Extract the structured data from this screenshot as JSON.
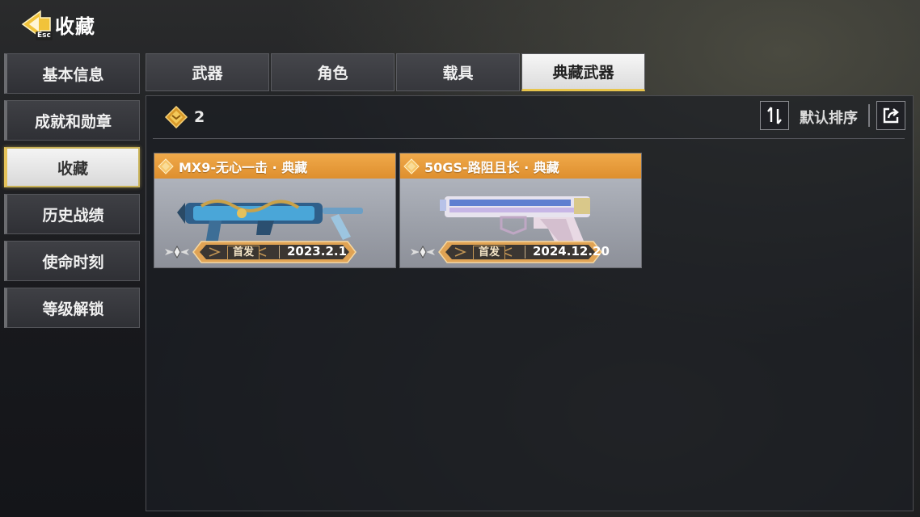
{
  "header": {
    "title": "收藏",
    "esc_label": "Esc"
  },
  "sidebar": {
    "items": [
      {
        "label": "基本信息",
        "active": false
      },
      {
        "label": "成就和勋章",
        "active": false
      },
      {
        "label": "收藏",
        "active": true
      },
      {
        "label": "历史战绩",
        "active": false
      },
      {
        "label": "使命时刻",
        "active": false
      },
      {
        "label": "等级解锁",
        "active": false
      }
    ]
  },
  "tabs": [
    {
      "label": "武器",
      "active": false
    },
    {
      "label": "角色",
      "active": false
    },
    {
      "label": "载具",
      "active": false
    },
    {
      "label": "典藏武器",
      "active": true
    }
  ],
  "toolbar": {
    "count": "2",
    "sort_label": "默认排序",
    "icons": {
      "count": "diamond-rank-icon",
      "sort": "sort-arrows-icon",
      "share": "share-icon"
    }
  },
  "cards": [
    {
      "title": "MX9-无心一击 · 典藏",
      "first_label": "首发",
      "date": "2023.2.1",
      "weapon_icon": "smg-weapon-icon"
    },
    {
      "title": "50GS-路阻且长 · 典藏",
      "first_label": "首发",
      "date": "2024.12.20",
      "weapon_icon": "pistol-weapon-icon"
    }
  ],
  "colors": {
    "accent_gold": "#e8c54c",
    "card_header": "#e89a38",
    "active_tab_bg": "#ececec"
  }
}
